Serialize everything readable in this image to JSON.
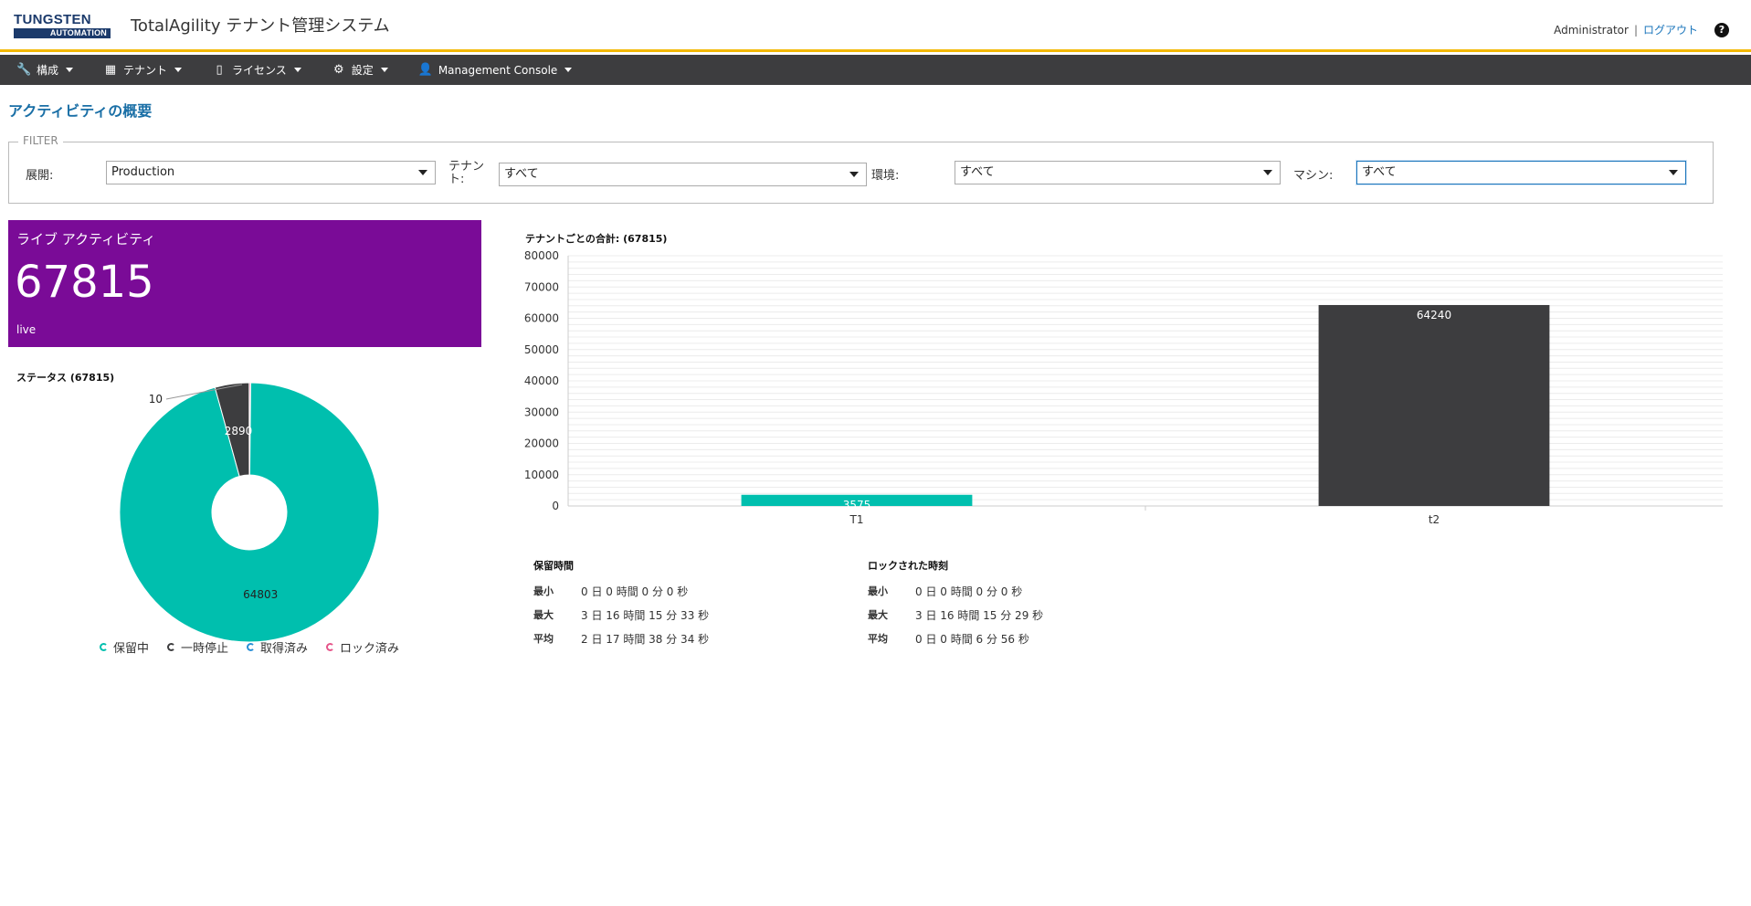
{
  "header": {
    "logo_top": "TUNGSTEN",
    "logo_bottom": "AUTOMATION",
    "title": "TotalAgility テナント管理システム",
    "user": "Administrator",
    "separator": "|",
    "logout": "ログアウト",
    "help": "?"
  },
  "nav": {
    "items": [
      {
        "label": "構成"
      },
      {
        "label": "テナント"
      },
      {
        "label": "ライセンス"
      },
      {
        "label": "設定"
      },
      {
        "label": "Management Console"
      }
    ]
  },
  "page_title": "アクティビティの概要",
  "filter": {
    "legend": "FILTER",
    "deployment_label": "展開:",
    "deployment_value": "Production",
    "tenant_label": "テナント:",
    "tenant_value": "すべて",
    "environment_label": "環境:",
    "environment_value": "すべて",
    "machine_label": "マシン:",
    "machine_value": "すべて"
  },
  "live": {
    "title": "ライブ アクティビティ",
    "value": "67815",
    "status": "live",
    "color": "#7a0b97"
  },
  "chart_data": [
    {
      "type": "pie",
      "title": "ステータス (67815)",
      "categories": [
        "保留中",
        "一時停止",
        "取得済み",
        "ロック済み"
      ],
      "values": [
        64803,
        2890,
        10,
        112
      ],
      "value_labels": [
        "64803",
        "2890",
        "10",
        ""
      ],
      "colors": [
        "#00bfae",
        "#3d3d3f",
        "#2a8fd6",
        "#e6558a"
      ]
    },
    {
      "type": "bar",
      "title": "テナントごとの合計: (67815)",
      "categories": [
        "T1",
        "t2"
      ],
      "values": [
        3575,
        64240
      ],
      "colors": [
        "#00bfae",
        "#3d3d3f"
      ],
      "ylim": [
        0,
        80000
      ],
      "yticks": [
        0,
        10000,
        20000,
        30000,
        40000,
        50000,
        60000,
        70000,
        80000
      ]
    }
  ],
  "stats": {
    "hold": {
      "title": "保留時間",
      "rows": [
        {
          "k": "最小",
          "v": "0 日 0 時間 0 分 0 秒"
        },
        {
          "k": "最大",
          "v": "3 日 16 時間 15 分 33 秒"
        },
        {
          "k": "平均",
          "v": "2 日 17 時間 38 分 34 秒"
        }
      ]
    },
    "locked": {
      "title": "ロックされた時刻",
      "rows": [
        {
          "k": "最小",
          "v": "0 日 0 時間 0 分 0 秒"
        },
        {
          "k": "最大",
          "v": "3 日 16 時間 15 分 29 秒"
        },
        {
          "k": "平均",
          "v": "0 日 0 時間 6 分 56 秒"
        }
      ]
    }
  }
}
